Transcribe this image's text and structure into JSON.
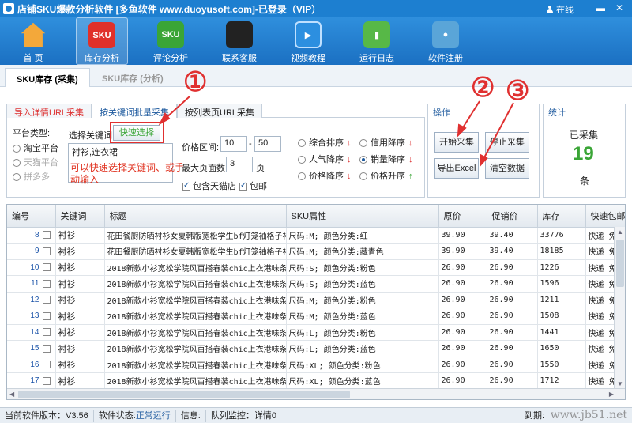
{
  "window": {
    "title": "店铺SKU爆款分析软件 [多鱼软件 www.duoyusoft.com]-已登录（VIP）",
    "user_status": "在线",
    "min": "▬",
    "close": "✕"
  },
  "toolbar": [
    {
      "label": "首 页",
      "icon": "home-icon"
    },
    {
      "label": "库存分析",
      "icon": "sku-icon",
      "text": "SKU"
    },
    {
      "label": "评论分析",
      "icon": "sku-green-icon",
      "text": "SKU"
    },
    {
      "label": "联系客服",
      "icon": "qq-icon"
    },
    {
      "label": "视频教程",
      "icon": "play-icon"
    },
    {
      "label": "运行日志",
      "icon": "log-icon"
    },
    {
      "label": "软件注册",
      "icon": "register-icon"
    }
  ],
  "main_tabs": [
    "SKU库存 (采集)",
    "SKU库存 (分析)"
  ],
  "sub_tabs": [
    "导入详情URL采集",
    "按关键词批量采集",
    "按列表页URL采集"
  ],
  "platform": {
    "label": "平台类型:",
    "options": [
      "淘宝平台",
      "天猫平台",
      "拼多多"
    ]
  },
  "keyword": {
    "label": "选择关键词:",
    "quick_select": "快速选择",
    "value": "衬衫,连衣裙",
    "hint": "可以快速选择关键词、或手动输入"
  },
  "price": {
    "label": "价格区间:",
    "min": "10",
    "dash": "-",
    "max": "50"
  },
  "pages": {
    "label": "最大页面数:",
    "value": "3",
    "unit": "页"
  },
  "include_tmall": "包含天猫店",
  "free_shipping": "包邮",
  "sort": {
    "options": [
      "综合排序",
      "信用降序",
      "人气降序",
      "销量降序",
      "价格降序",
      "价格升序"
    ],
    "arrows": {
      "down": "↓",
      "up": "↑"
    }
  },
  "operation": {
    "title": "操作",
    "start": "开始采集",
    "stop": "停止采集",
    "export": "导出Excel",
    "clear": "清空数据"
  },
  "stats": {
    "title": "统计",
    "label": "已采集",
    "count": "19",
    "unit": "条"
  },
  "annotations": [
    "①",
    "②",
    "③"
  ],
  "table": {
    "headers": [
      "编号",
      "关键词",
      "标题",
      "SKU属性",
      "原价",
      "促销价",
      "库存",
      "快速包邮"
    ],
    "rows": [
      [
        "8",
        "衬衫",
        "花田餐厨防晒衬衫女夏韩版宽松学生bf灯笼袖格子衬...",
        "尺码:M; 颜色分类:红",
        "39.90",
        "39.40",
        "33776",
        "快递 免"
      ],
      [
        "9",
        "衬衫",
        "花田餐厨防晒衬衫女夏韩版宽松学生bf灯笼袖格子衬...",
        "尺码:M; 颜色分类:藏青色",
        "39.90",
        "39.40",
        "18185",
        "快递 免"
      ],
      [
        "10",
        "衬衫",
        "2018新款小衫宽松学院风百搭春装chic上衣港味条纹...",
        "尺码:S; 颜色分类:粉色",
        "26.90",
        "26.90",
        "1226",
        "快递 免"
      ],
      [
        "11",
        "衬衫",
        "2018新款小衫宽松学院风百搭春装chic上衣港味条纹...",
        "尺码:S; 颜色分类:蓝色",
        "26.90",
        "26.90",
        "1596",
        "快递 免"
      ],
      [
        "12",
        "衬衫",
        "2018新款小衫宽松学院风百搭春装chic上衣港味条纹...",
        "尺码:M; 颜色分类:粉色",
        "26.90",
        "26.90",
        "1211",
        "快递 免"
      ],
      [
        "13",
        "衬衫",
        "2018新款小衫宽松学院风百搭春装chic上衣港味条纹...",
        "尺码:M; 颜色分类:蓝色",
        "26.90",
        "26.90",
        "1508",
        "快递 免"
      ],
      [
        "14",
        "衬衫",
        "2018新款小衫宽松学院风百搭春装chic上衣港味条纹...",
        "尺码:L; 颜色分类:粉色",
        "26.90",
        "26.90",
        "1441",
        "快递 免"
      ],
      [
        "15",
        "衬衫",
        "2018新款小衫宽松学院风百搭春装chic上衣港味条纹...",
        "尺码:L; 颜色分类:蓝色",
        "26.90",
        "26.90",
        "1650",
        "快递 免"
      ],
      [
        "16",
        "衬衫",
        "2018新款小衫宽松学院风百搭春装chic上衣港味条纹...",
        "尺码:XL; 颜色分类:粉色",
        "26.90",
        "26.90",
        "1550",
        "快递 免"
      ],
      [
        "17",
        "衬衫",
        "2018新款小衫宽松学院风百搭春装chic上衣港味条纹...",
        "尺码:XL; 颜色分类:蓝色",
        "26.90",
        "26.90",
        "1712",
        "快递 免"
      ]
    ]
  },
  "status": {
    "version": "当前软件版本：V3.56",
    "state_label": "软件状态:",
    "state_value": "正常运行",
    "info_label": "信息:",
    "queue": "队列监控：详情0",
    "expire": "到期:",
    "watermark": "www.jb51.net"
  },
  "colors": {
    "accent": "#1d7fd0",
    "annotation": "#e03030",
    "count": "#3aa536"
  }
}
